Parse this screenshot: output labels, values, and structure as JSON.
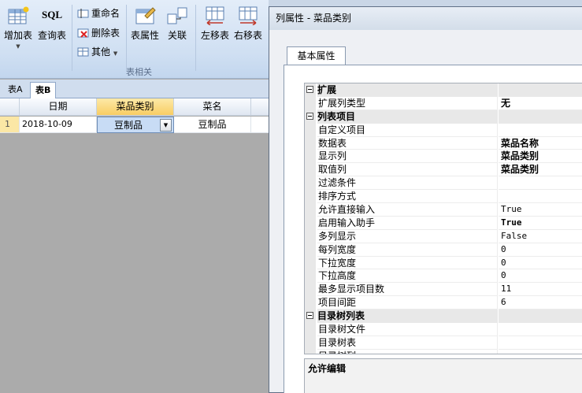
{
  "ribbon": {
    "add_table": "增加表",
    "query_table": "查询表",
    "sql_text": "SQL",
    "rename": "重命名",
    "delete_table": "删除表",
    "other": "其他",
    "table_props": "表属性",
    "relation": "关联",
    "move_left": "左移表",
    "move_right": "右移表",
    "group_label": "表相关"
  },
  "sheet_tabs": [
    "表A",
    "表B"
  ],
  "grid": {
    "columns": [
      "日期",
      "菜品类别",
      "菜名"
    ],
    "rows": [
      {
        "num": "1",
        "date": "2018-10-09",
        "category": "豆制品",
        "name": "豆制品"
      }
    ]
  },
  "dialog": {
    "title": "列属性 - 菜品类别",
    "tab": "基本属性",
    "categories": [
      {
        "label": "扩展",
        "props": [
          {
            "name": "扩展列类型",
            "value": "无",
            "style": "bold"
          }
        ]
      },
      {
        "label": "列表项目",
        "props": [
          {
            "name": "自定义项目",
            "value": "",
            "style": ""
          },
          {
            "name": "数据表",
            "value": "菜品名称",
            "style": "bold"
          },
          {
            "name": "显示列",
            "value": "菜品类别",
            "style": "bold"
          },
          {
            "name": "取值列",
            "value": "菜品类别",
            "style": "bold"
          },
          {
            "name": "过滤条件",
            "value": "",
            "style": ""
          },
          {
            "name": "排序方式",
            "value": "",
            "style": ""
          },
          {
            "name": "允许直接输入",
            "value": "True",
            "style": "mono"
          },
          {
            "name": "启用输入助手",
            "value": "True",
            "style": "mono bold"
          },
          {
            "name": "多列显示",
            "value": "False",
            "style": "mono"
          },
          {
            "name": "每列宽度",
            "value": "0",
            "style": "mono"
          },
          {
            "name": "下拉宽度",
            "value": "0",
            "style": "mono"
          },
          {
            "name": "下拉高度",
            "value": "0",
            "style": "mono"
          },
          {
            "name": "最多显示项目数",
            "value": "11",
            "style": "mono"
          },
          {
            "name": "项目间距",
            "value": "6",
            "style": "mono"
          }
        ]
      },
      {
        "label": "目录树列表",
        "props": [
          {
            "name": "目录树文件",
            "value": "",
            "style": ""
          },
          {
            "name": "目录树表",
            "value": "",
            "style": ""
          },
          {
            "name": "目录树列",
            "value": "",
            "style": ""
          }
        ]
      }
    ],
    "description": "允许编辑"
  }
}
